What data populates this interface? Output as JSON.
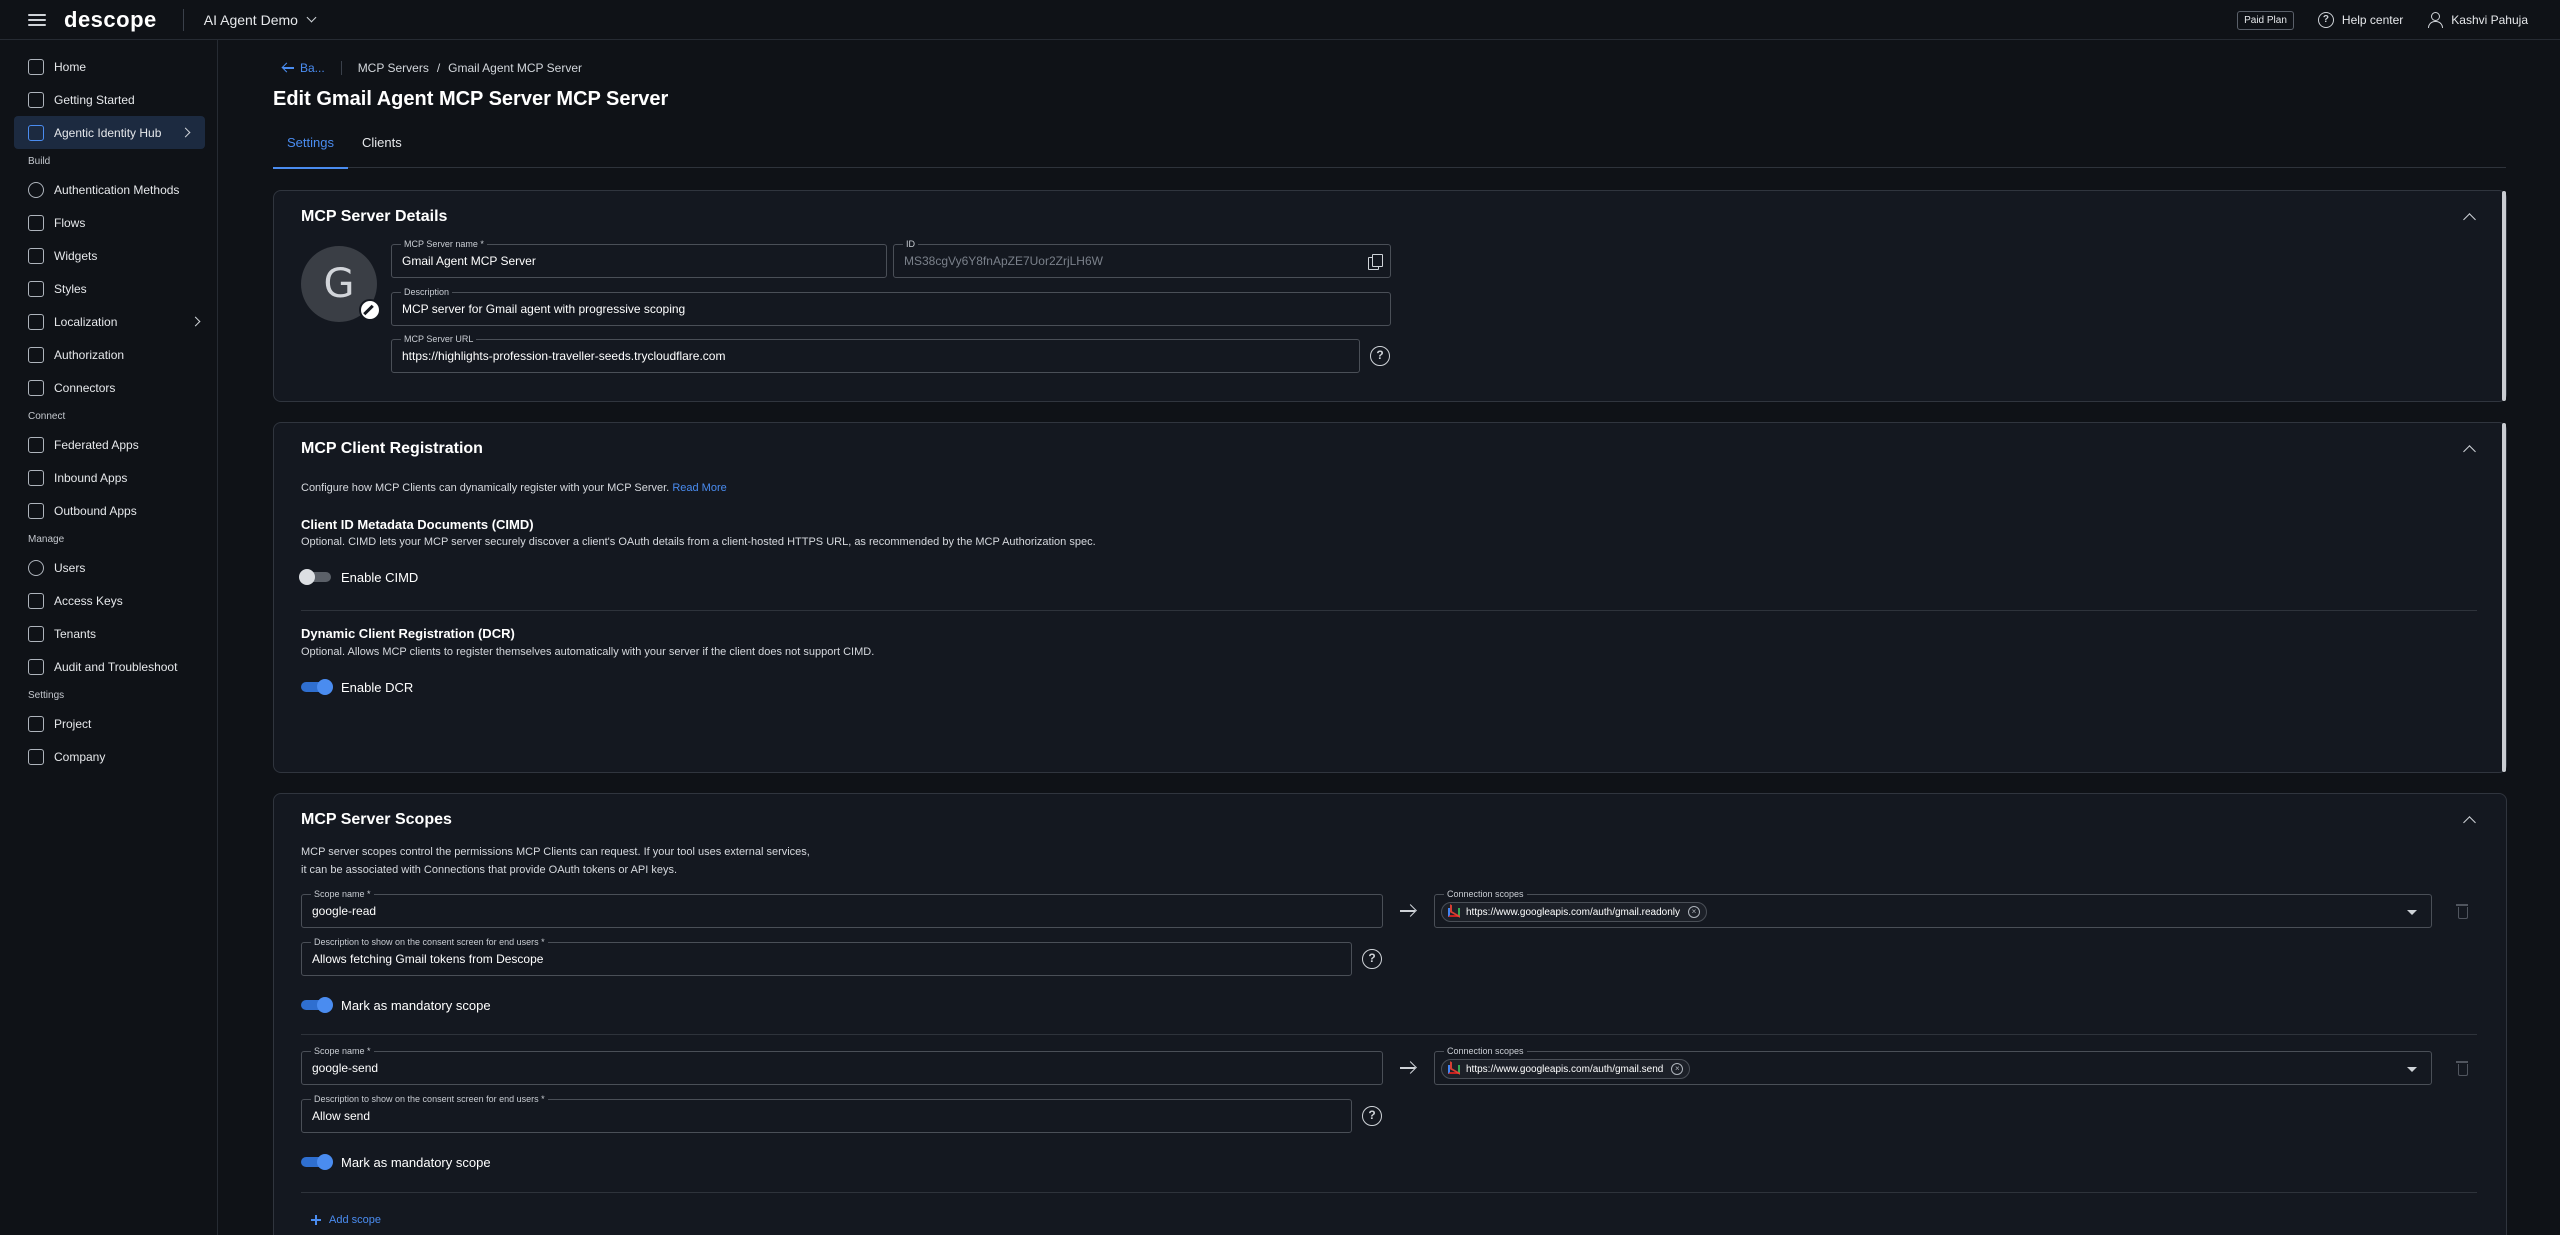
{
  "topbar": {
    "logo": "descope",
    "project": "AI Agent Demo",
    "paid_plan": "Paid Plan",
    "help_center": "Help center",
    "user_name": "Kashvi Pahuja"
  },
  "sidebar": {
    "home": "Home",
    "getting_started": "Getting Started",
    "agentic_hub": "Agentic Identity Hub",
    "section_build": "Build",
    "auth_methods": "Authentication Methods",
    "flows": "Flows",
    "widgets": "Widgets",
    "styles": "Styles",
    "localization": "Localization",
    "authorization": "Authorization",
    "connectors": "Connectors",
    "section_connect": "Connect",
    "federated_apps": "Federated Apps",
    "inbound_apps": "Inbound Apps",
    "outbound_apps": "Outbound Apps",
    "section_manage": "Manage",
    "users": "Users",
    "access_keys": "Access Keys",
    "tenants": "Tenants",
    "audit": "Audit and Troubleshoot",
    "section_settings": "Settings",
    "project": "Project",
    "company": "Company"
  },
  "breadcrumb": {
    "back": "Ba...",
    "parent": "MCP Servers",
    "sep": "/",
    "current": "Gmail Agent MCP Server"
  },
  "page_title": "Edit Gmail Agent MCP Server MCP Server",
  "tabs": {
    "settings": "Settings",
    "clients": "Clients"
  },
  "details": {
    "title": "MCP Server Details",
    "avatar_letter": "G",
    "name_label": "MCP Server name *",
    "name_value": "Gmail Agent MCP Server",
    "id_label": "ID",
    "id_value": "MS38cgVy6Y8fnApZE7Uor2ZrjLH6W",
    "desc_label": "Description",
    "desc_value": "MCP server for Gmail agent with progressive scoping",
    "url_label": "MCP Server URL",
    "url_value": "https://highlights-profession-traveller-seeds.trycloudflare.com",
    "help_glyph": "?"
  },
  "registration": {
    "title": "MCP Client Registration",
    "intro": "Configure how MCP Clients can dynamically register with your MCP Server.",
    "read_more": "Read More",
    "cimd_title": "Client ID Metadata Documents (CIMD)",
    "cimd_desc": "Optional. CIMD lets your MCP server securely discover a client's OAuth details from a client-hosted HTTPS URL, as recommended by the MCP Authorization spec.",
    "cimd_toggle": "Enable CIMD",
    "cimd_enabled": false,
    "dcr_title": "Dynamic Client Registration (DCR)",
    "dcr_desc": "Optional. Allows MCP clients to register themselves automatically with your server if the client does not support CIMD.",
    "dcr_toggle": "Enable DCR",
    "dcr_enabled": true
  },
  "scopes": {
    "title": "MCP Server Scopes",
    "intro_line1": "MCP server scopes control the permissions MCP Clients can request. If your tool uses external services,",
    "intro_line2": "it can be associated with Connections that provide OAuth tokens or API keys.",
    "scope_name_label": "Scope name *",
    "desc_label": "Description to show on the consent screen for end users *",
    "conn_label": "Connection scopes",
    "mandatory_label": "Mark as mandatory scope",
    "add_scope": "Add scope",
    "items": [
      {
        "name": "google-read",
        "description": "Allows fetching Gmail tokens from Descope",
        "connection_scope": "https://www.googleapis.com/auth/gmail.readonly",
        "mandatory": true
      },
      {
        "name": "google-send",
        "description": "Allow send",
        "connection_scope": "https://www.googleapis.com/auth/gmail.send",
        "mandatory": true
      }
    ]
  },
  "colors": {
    "accent": "#4a8cf0",
    "background": "#0f1217",
    "card": "#141820"
  }
}
